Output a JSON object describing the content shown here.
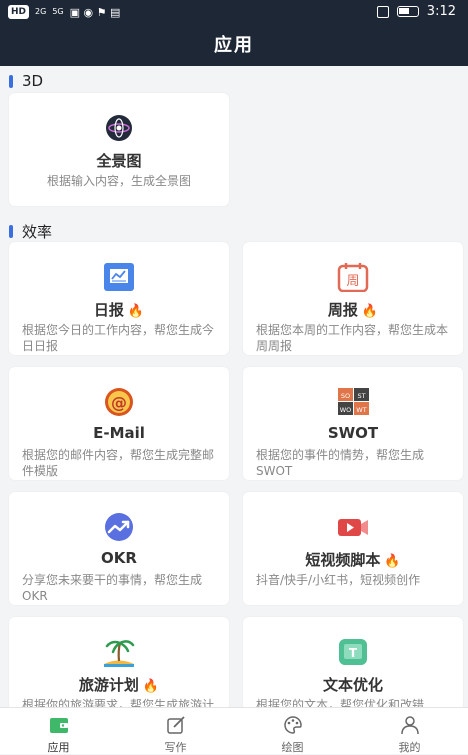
{
  "status": {
    "carrier_badge": "HD",
    "signal1": "2G",
    "signal2": "5G",
    "time": "3:12"
  },
  "page_title": "应用",
  "sections": [
    {
      "title": "3D"
    },
    {
      "title": "效率"
    }
  ],
  "cards": {
    "panorama": {
      "title": "全景图",
      "desc": "根据输入内容，生成全景图"
    },
    "daily": {
      "title": "日报",
      "hot": "🔥",
      "desc": "根据您今日的工作内容，帮您生成今日日报"
    },
    "weekly": {
      "title": "周报",
      "hot": "🔥",
      "icon_text": "周",
      "desc": "根据您本周的工作内容，帮您生成本周周报"
    },
    "email": {
      "title": "E-Mail",
      "icon_text": "@",
      "desc": "根据您的邮件内容，帮您生成完整邮件模版"
    },
    "swot": {
      "title": "SWOT",
      "icon_cells": [
        "SO",
        "ST",
        "WO",
        "WT"
      ],
      "desc": "根据您的事件的情势，帮您生成 SWOT"
    },
    "okr": {
      "title": "OKR",
      "desc": "分享您未来要干的事情，帮您生成 OKR"
    },
    "shortvideo": {
      "title": "短视频脚本",
      "hot": "🔥",
      "desc": "抖音/快手/小红书，短视频创作"
    },
    "travel": {
      "title": "旅游计划",
      "hot": "🔥",
      "desc": "根据你的旅游要求，帮您生成旅游计划"
    },
    "textopt": {
      "title": "文本优化",
      "icon_text": "T",
      "desc": "根据您的文本，帮您优化和改错"
    }
  },
  "tabs": [
    {
      "label": "应用"
    },
    {
      "label": "写作"
    },
    {
      "label": "绘图"
    },
    {
      "label": "我的"
    }
  ],
  "colors": {
    "header": "#1e2735",
    "accent": "#3b6fe0",
    "fire": "#f25b1e"
  }
}
